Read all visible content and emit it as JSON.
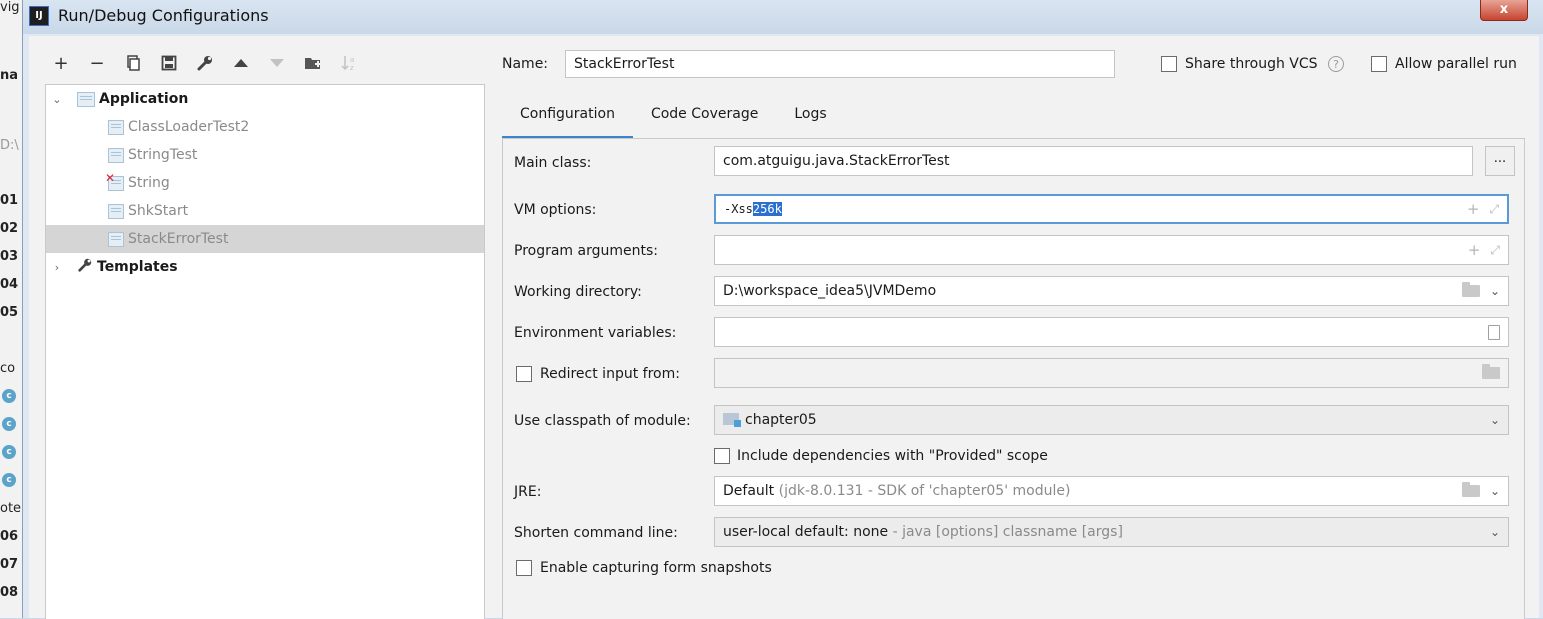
{
  "window": {
    "title": "Run/Debug Configurations",
    "app_icon_text": "IJ",
    "close_glyph": "x"
  },
  "background_app": {
    "fragments": [
      "vig",
      "na",
      "D:\\",
      "01",
      "02",
      "03",
      "04",
      "05",
      "co",
      "c",
      "c",
      "c",
      "c",
      "ote",
      "06",
      "07",
      "08"
    ]
  },
  "toolbar": {
    "icons": [
      "add-icon",
      "remove-icon",
      "copy-icon",
      "save-icon",
      "wrench-icon",
      "move-up-icon",
      "move-down-icon",
      "folder-add-icon",
      "sort-icon"
    ]
  },
  "tree": {
    "application": {
      "label": "Application",
      "children": [
        "ClassLoaderTest2",
        "StringTest",
        "String",
        "ShkStart",
        "StackErrorTest"
      ]
    },
    "templates": {
      "label": "Templates"
    },
    "selected": "StackErrorTest"
  },
  "header": {
    "name_label": "Name:",
    "name_value": "StackErrorTest",
    "share_vcs_label": "Share through VCS",
    "help_glyph": "?",
    "allow_parallel_label": "Allow parallel run"
  },
  "tabs": [
    "Configuration",
    "Code Coverage",
    "Logs"
  ],
  "active_tab": "Configuration",
  "form": {
    "main_class_label": "Main class:",
    "main_class_value": "com.atguigu.java.StackErrorTest",
    "browse_label": "...",
    "vm_options_label": "VM options:",
    "vm_options_prefix": "-Xss",
    "vm_options_selected": "256k",
    "program_args_label": "Program arguments:",
    "program_args_value": "",
    "working_dir_label": "Working directory:",
    "working_dir_value": "D:\\workspace_idea5\\JVMDemo",
    "env_vars_label": "Environment variables:",
    "env_vars_value": "",
    "redirect_label": "Redirect input from:",
    "classpath_label": "Use classpath of module:",
    "classpath_value": "chapter05",
    "include_deps_label": "Include dependencies with \"Provided\" scope",
    "jre_label": "JRE:",
    "jre_value": "Default",
    "jre_detail": "(jdk-8.0.131 - SDK of 'chapter05' module)",
    "shorten_label": "Shorten command line:",
    "shorten_value": "user-local default: none",
    "shorten_detail": "- java [options] classname [args]",
    "capture_label": "Enable capturing form snapshots"
  },
  "colors": {
    "accent": "#4083c9",
    "selection": "#2b6fcf",
    "error": "#e0283a"
  }
}
